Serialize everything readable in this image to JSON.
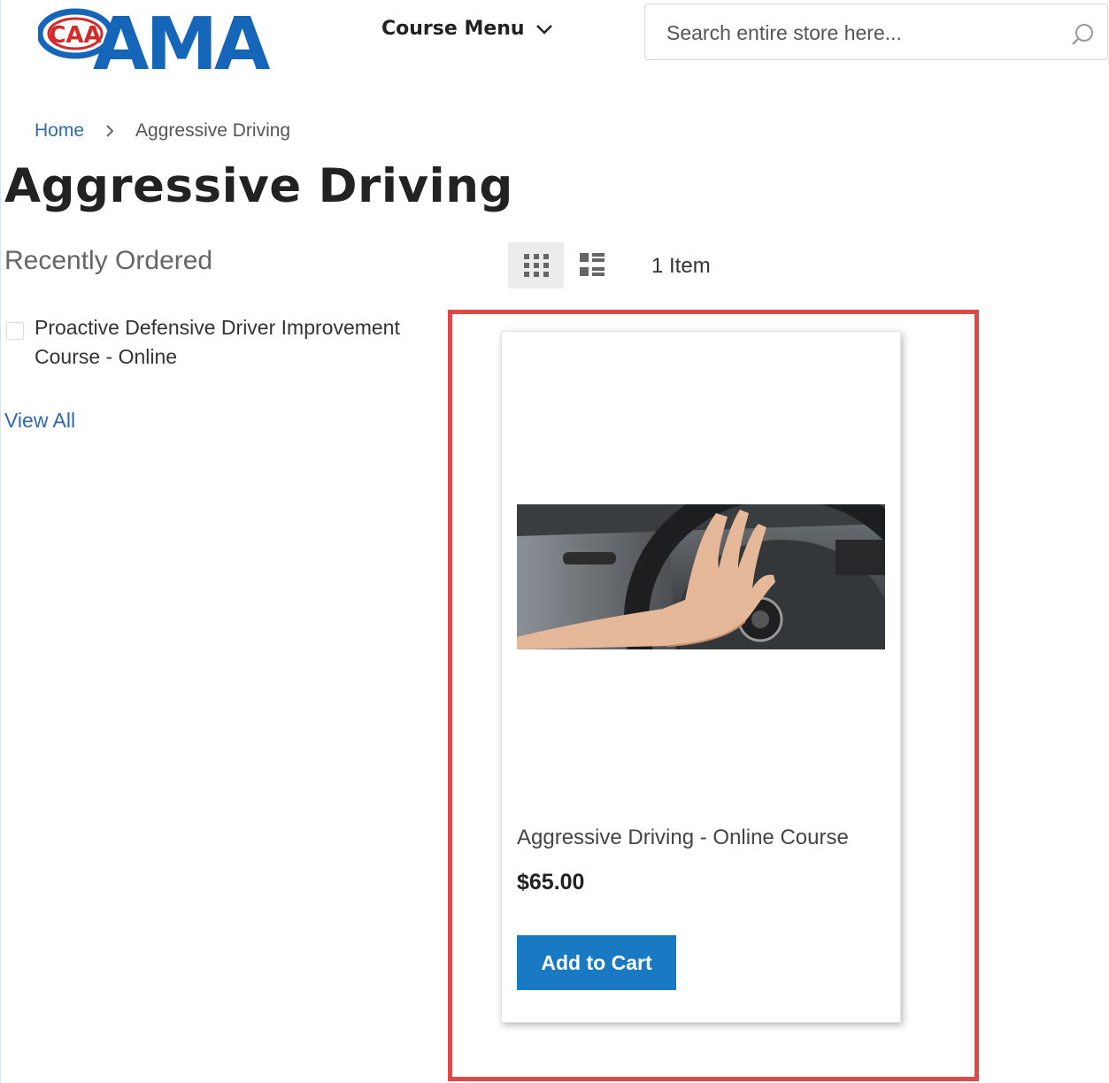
{
  "header": {
    "logo": {
      "badge_text": "CAA",
      "brand_text": "AMA"
    },
    "course_menu_label": "Course Menu",
    "search": {
      "placeholder": "Search entire store here..."
    }
  },
  "breadcrumb": {
    "home": "Home",
    "current": "Aggressive Driving"
  },
  "page_title": "Aggressive Driving",
  "sidebar": {
    "title": "Recently Ordered",
    "items": [
      {
        "label": "Proactive Defensive Driver Improvement Course - Online"
      }
    ],
    "view_all": "View All"
  },
  "toolbar": {
    "modes": [
      "grid",
      "list"
    ],
    "active_mode": "grid",
    "amount": "1 Item"
  },
  "products": [
    {
      "name": "Aggressive Driving - Online Course",
      "price": "$65.00",
      "button_label": "Add to Cart"
    }
  ],
  "colors": {
    "brand_blue": "#1565b8",
    "brand_red": "#d42a2a",
    "button_blue": "#1979c3",
    "link_blue": "#2f6aa8",
    "highlight_red": "#e04848"
  }
}
